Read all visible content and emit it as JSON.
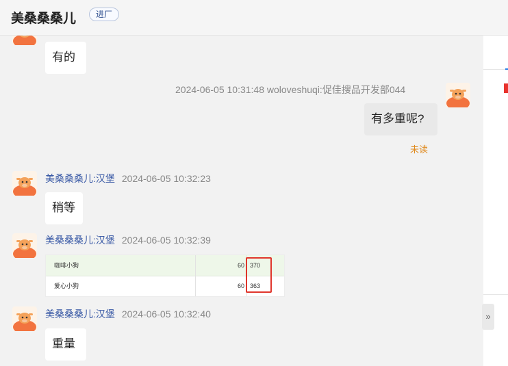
{
  "header": {
    "title": "美桑桑桑儿",
    "badge": "进厂"
  },
  "messages": [
    {
      "text": "有的"
    },
    {
      "meta": "2024-06-05 10:31:48  woloveshuqi:促佳搜品开发部044",
      "text": "有多重呢?",
      "status": "未读"
    },
    {
      "sender": "美桑桑桑儿:汉堡",
      "time": "2024-06-05 10:32:23",
      "text": "稍等"
    },
    {
      "sender": "美桑桑桑儿:汉堡",
      "time": "2024-06-05 10:32:39",
      "image_table": [
        {
          "name": "咖啡小狗",
          "a": "60",
          "b": "370"
        },
        {
          "name": "爱心小狗",
          "a": "60",
          "b": "363"
        }
      ]
    },
    {
      "sender": "美桑桑桑儿:汉堡",
      "time": "2024-06-05 10:32:40",
      "text": "重量"
    }
  ],
  "icons": {
    "expand": "double-chevron-right-icon",
    "avatar": "cow-avatar"
  },
  "colors": {
    "accent": "#2a80e8",
    "unread": "#e08a1e",
    "highlight": "#e0352b",
    "sender": "#3a5aa6"
  }
}
